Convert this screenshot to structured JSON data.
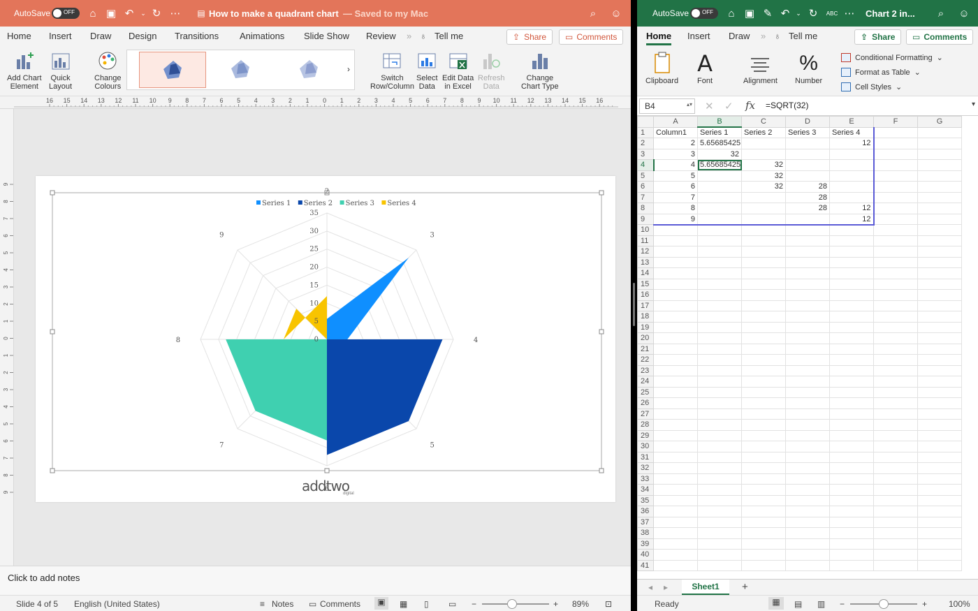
{
  "ppt": {
    "autosave_label": "AutoSave",
    "autosave_state": "OFF",
    "title": "How to make a quadrant chart",
    "title_status": "— Saved to my Mac",
    "tabs": [
      "Home",
      "Insert",
      "Draw",
      "Design",
      "Transitions",
      "Animations",
      "Slide Show",
      "Review"
    ],
    "tell_me": "Tell me",
    "share_label": "Share",
    "comments_label": "Comments",
    "ribbon": {
      "add_chart_element": [
        "Add Chart",
        "Element"
      ],
      "quick_layout": [
        "Quick",
        "Layout"
      ],
      "change_colours": [
        "Change",
        "Colours"
      ],
      "switch_row_column": [
        "Switch",
        "Row/Column"
      ],
      "select_data": [
        "Select",
        "Data"
      ],
      "edit_data_in_excel": [
        "Edit Data",
        "in Excel"
      ],
      "refresh_data": [
        "Refresh",
        "Data"
      ],
      "change_chart_type": [
        "Change",
        "Chart Type"
      ]
    },
    "ruler_labels": [
      "16",
      "15",
      "14",
      "13",
      "12",
      "11",
      "10",
      "9",
      "8",
      "7",
      "6",
      "5",
      "4",
      "3",
      "2",
      "1",
      "0",
      "1",
      "2",
      "3",
      "4",
      "5",
      "6",
      "7",
      "8",
      "9",
      "10",
      "11",
      "12",
      "13",
      "14",
      "15",
      "16"
    ],
    "vruler_labels": [
      "9",
      "8",
      "7",
      "6",
      "5",
      "4",
      "3",
      "2",
      "1",
      "0",
      "1",
      "2",
      "3",
      "4",
      "5",
      "6",
      "7",
      "8",
      "9"
    ],
    "notes_placeholder": "Click to add notes",
    "status": {
      "slide": "Slide 4 of 5",
      "language": "English (United States)",
      "notes": "Notes",
      "comments": "Comments",
      "zoom": "89%"
    },
    "logo_text": "addtwo",
    "logo_subtext": "digital"
  },
  "chart_data": {
    "type": "radar",
    "title": "",
    "categories": [
      "2",
      "3",
      "4",
      "5",
      "6",
      "7",
      "8",
      "9"
    ],
    "rlim": [
      0,
      35
    ],
    "ticks": [
      0,
      5,
      10,
      15,
      20,
      25,
      30,
      35
    ],
    "legend_position": "top",
    "filled": true,
    "series": [
      {
        "name": "Series 1",
        "color": "#0f8fff",
        "values": [
          5.65685425,
          32,
          5.65685425,
          null,
          null,
          null,
          null,
          null
        ]
      },
      {
        "name": "Series 2",
        "color": "#0a47ab",
        "values": [
          null,
          null,
          32,
          32,
          32,
          null,
          null,
          null
        ]
      },
      {
        "name": "Series 3",
        "color": "#3fd0b0",
        "values": [
          null,
          null,
          null,
          null,
          28,
          28,
          28,
          null
        ]
      },
      {
        "name": "Series 4",
        "color": "#f8c400",
        "values": [
          12,
          null,
          null,
          null,
          null,
          null,
          12,
          12
        ]
      }
    ]
  },
  "excel": {
    "autosave_label": "AutoSave",
    "autosave_state": "OFF",
    "title": "Chart 2 in...",
    "tabs": [
      "Home",
      "Insert",
      "Draw"
    ],
    "tell_me": "Tell me",
    "share_label": "Share",
    "comments_label": "Comments",
    "ribbon": {
      "clipboard": "Clipboard",
      "font": "Font",
      "alignment": "Alignment",
      "number": "Number",
      "conditional_formatting": "Conditional Formatting",
      "format_as_table": "Format as Table",
      "cell_styles": "Cell Styles"
    },
    "name_box": "B4",
    "formula": "=SQRT(32)",
    "columns": [
      "A",
      "B",
      "C",
      "D",
      "E",
      "F",
      "G"
    ],
    "rows": [
      [
        "Column1",
        "Series 1",
        "Series 2",
        "Series 3",
        "Series 4",
        "",
        ""
      ],
      [
        "2",
        "5.65685425",
        "",
        "",
        "12",
        "",
        ""
      ],
      [
        "3",
        "32",
        "",
        "",
        "",
        "",
        ""
      ],
      [
        "4",
        "5.65685425",
        "32",
        "",
        "",
        "",
        ""
      ],
      [
        "5",
        "",
        "32",
        "",
        "",
        "",
        ""
      ],
      [
        "6",
        "",
        "32",
        "28",
        "",
        "",
        ""
      ],
      [
        "7",
        "",
        "",
        "28",
        "",
        "",
        ""
      ],
      [
        "8",
        "",
        "",
        "28",
        "12",
        "",
        ""
      ],
      [
        "9",
        "",
        "",
        "",
        "12",
        "",
        ""
      ]
    ],
    "total_rows": 41,
    "sheet_tab": "Sheet1",
    "status": {
      "ready": "Ready",
      "zoom": "100%"
    }
  }
}
